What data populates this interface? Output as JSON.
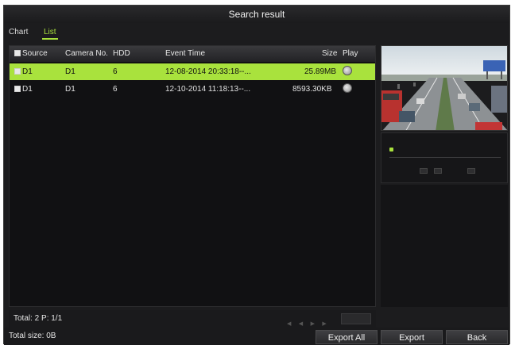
{
  "window": {
    "title": "Search result"
  },
  "tabs": [
    {
      "label": "Chart",
      "active": false
    },
    {
      "label": "List",
      "active": true
    }
  ],
  "table": {
    "headers": {
      "source": "Source",
      "camera": "Camera No.",
      "hdd": "HDD",
      "event_time": "Event Time",
      "size": "Size",
      "play": "Play"
    },
    "rows": [
      {
        "source": "D1",
        "camera": "D1",
        "hdd": "6",
        "event_time": "12-08-2014 20:33:18--...",
        "size": "25.89MB",
        "selected": true
      },
      {
        "source": "D1",
        "camera": "D1",
        "hdd": "6",
        "event_time": "12-10-2014 11:18:13--...",
        "size": "8593.30KB",
        "selected": false
      }
    ]
  },
  "pager": {
    "total": "Total: 2  P: 1/1"
  },
  "footer": {
    "total_size": "Total size: 0B",
    "export_all": "Export All",
    "export": "Export",
    "back": "Back"
  },
  "colors": {
    "accent": "#a9e23d",
    "background": "#1c1c1e"
  },
  "icons": {
    "play": "play-circle-icon",
    "checkbox": "checkbox-icon"
  }
}
